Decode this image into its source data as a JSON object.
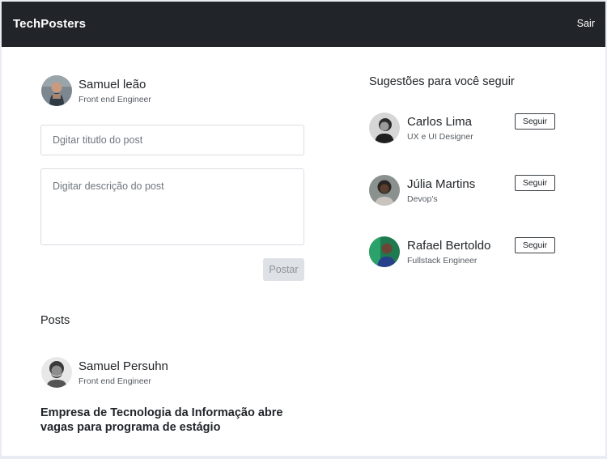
{
  "header": {
    "brand": "TechPosters",
    "logout_label": "Sair"
  },
  "profile": {
    "name": "Samuel leão",
    "role": "Front end Engineer"
  },
  "composer": {
    "title_placeholder": "Dgitar titutlo do post",
    "description_placeholder": "Digitar descrição do post",
    "submit_label": "Postar"
  },
  "posts": {
    "heading": "Posts",
    "items": [
      {
        "author": "Samuel Persuhn",
        "role": "Front end Engineer",
        "title": "Empresa de Tecnologia da Informação abre vagas para programa de estágio"
      }
    ]
  },
  "suggestions": {
    "heading": "Sugestões para você seguir",
    "follow_label": "Seguir",
    "items": [
      {
        "name": "Carlos Lima",
        "role": "UX e UI Designer"
      },
      {
        "name": "Júlia Martins",
        "role": "Devop's"
      },
      {
        "name": "Rafael Bertoldo",
        "role": "Fullstack Engineer"
      }
    ]
  },
  "colors": {
    "header_bg": "#212529",
    "page_bg": "#ffffff",
    "disabled_button_bg": "#dee1e5",
    "input_border": "#d9dce1"
  }
}
